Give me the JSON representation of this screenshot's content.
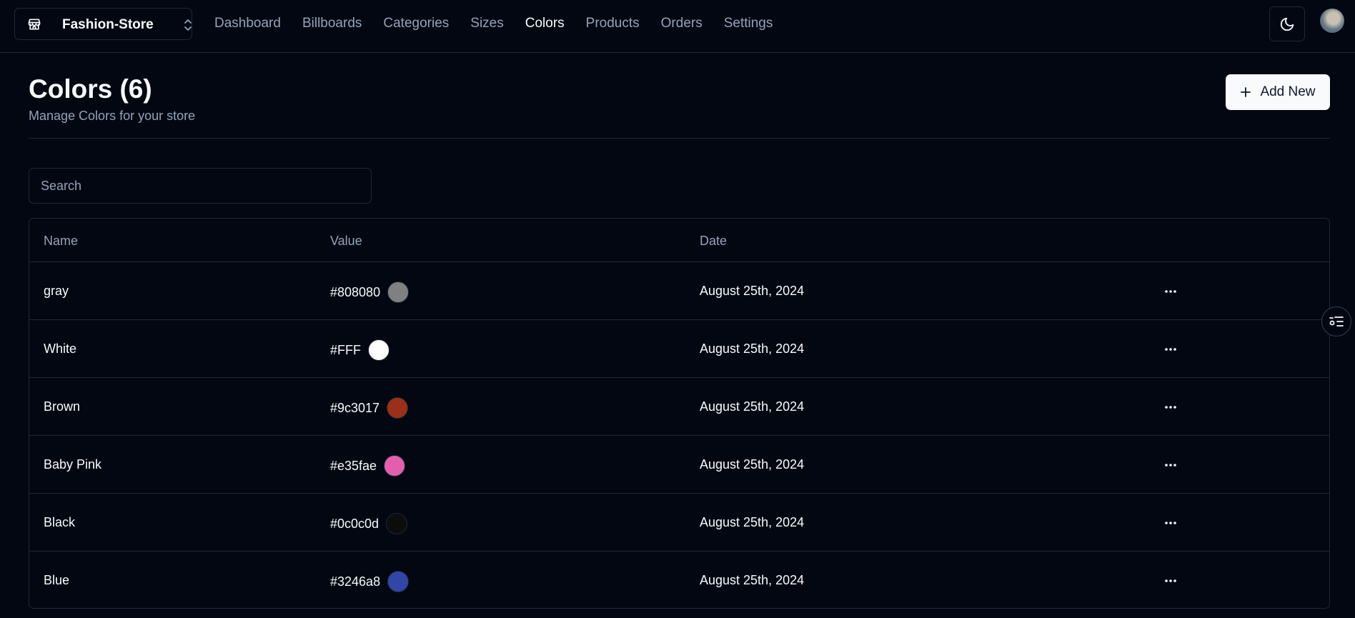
{
  "store": {
    "name": "Fashion-Store"
  },
  "nav": [
    "Dashboard",
    "Billboards",
    "Categories",
    "Sizes",
    "Colors",
    "Products",
    "Orders",
    "Settings"
  ],
  "nav_active": "Colors",
  "heading": {
    "title": "Colors (6)",
    "subtitle": "Manage Colors for your store"
  },
  "add_button": "Add New",
  "search": {
    "placeholder": "Search",
    "value": ""
  },
  "table": {
    "headers": {
      "name": "Name",
      "value": "Value",
      "date": "Date"
    },
    "rows": [
      {
        "name": "gray",
        "value": "#808080",
        "color": "#808080",
        "date": "August 25th, 2024"
      },
      {
        "name": "White",
        "value": "#FFF",
        "color": "#FFFFFF",
        "date": "August 25th, 2024"
      },
      {
        "name": "Brown",
        "value": "#9c3017",
        "color": "#9c3017",
        "date": "August 25th, 2024"
      },
      {
        "name": "Baby Pink",
        "value": "#e35fae",
        "color": "#e35fae",
        "date": "August 25th, 2024"
      },
      {
        "name": "Black",
        "value": "#0c0c0d",
        "color": "#0c0c0d",
        "date": "August 25th, 2024"
      },
      {
        "name": "Blue",
        "value": "#3246a8",
        "color": "#3246a8",
        "date": "August 25th, 2024"
      }
    ]
  },
  "icons": {
    "store": "store-icon",
    "switcher": "chevrons-up-down-icon",
    "theme": "moon-icon",
    "add": "plus-icon",
    "row_action": "more-horizontal-icon",
    "floating": "settings-list-icon"
  },
  "colors": {
    "background": "#030712",
    "border": "#1e293b",
    "muted": "#94a3b8",
    "foreground": "#f8fafc"
  }
}
